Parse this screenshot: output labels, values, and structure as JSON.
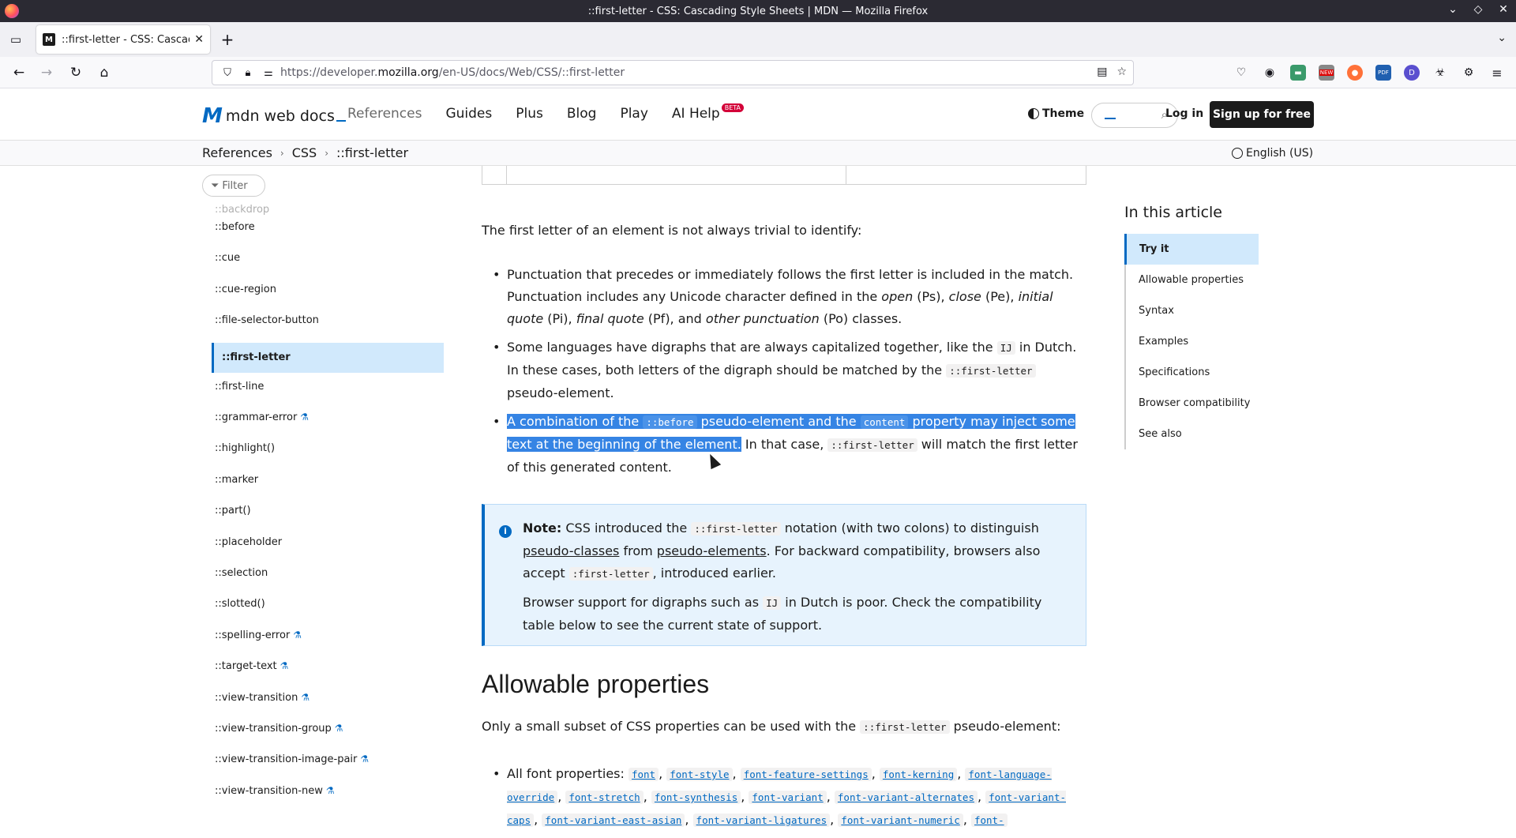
{
  "window": {
    "title": "::first-letter - CSS: Cascading Style Sheets | MDN — Mozilla Firefox"
  },
  "tab": {
    "title": "::first-letter - CSS: Cascading Style Sheets | MDN",
    "favicon": "M"
  },
  "urlbar": {
    "prefix": "https://developer.",
    "host": "mozilla.org",
    "path": "/en-US/docs/Web/CSS/::first-letter"
  },
  "extensions": {
    "new_badge": "NEW",
    "pdf_label": "PDF",
    "d_label": "D"
  },
  "header": {
    "logo": "mdn web docs",
    "nav": [
      "References",
      "Guides",
      "Plus",
      "Blog",
      "Play",
      "AI Help"
    ],
    "beta": "BETA",
    "theme": "Theme",
    "login": "Log in",
    "signup": "Sign up for free"
  },
  "breadcrumbs": [
    "References",
    "CSS",
    "::first-letter"
  ],
  "language": "English (US)",
  "sidebar": {
    "filter_placeholder": "Filter",
    "faded_item": "::backdrop",
    "items": [
      {
        "label": "::before",
        "experimental": false
      },
      {
        "label": "::cue",
        "experimental": false
      },
      {
        "label": "::cue-region",
        "experimental": false
      },
      {
        "label": "::file-selector-button",
        "experimental": false
      },
      {
        "label": "::first-letter",
        "experimental": false,
        "active": true
      },
      {
        "label": "::first-line",
        "experimental": false
      },
      {
        "label": "::grammar-error",
        "experimental": true
      },
      {
        "label": "::highlight()",
        "experimental": false
      },
      {
        "label": "::marker",
        "experimental": false
      },
      {
        "label": "::part()",
        "experimental": false
      },
      {
        "label": "::placeholder",
        "experimental": false
      },
      {
        "label": "::selection",
        "experimental": false
      },
      {
        "label": "::slotted()",
        "experimental": false
      },
      {
        "label": "::spelling-error",
        "experimental": true
      },
      {
        "label": "::target-text",
        "experimental": true
      },
      {
        "label": "::view-transition",
        "experimental": true
      },
      {
        "label": "::view-transition-group",
        "experimental": true
      },
      {
        "label": "::view-transition-image-pair",
        "experimental": true
      },
      {
        "label": "::view-transition-new",
        "experimental": true
      }
    ]
  },
  "content": {
    "intro": "The first letter of an element is not always trivial to identify:",
    "b1": {
      "t1": "Punctuation that precedes or immediately follows the first letter is included in the match. Punctuation includes any Unicode character defined in the ",
      "open": "open",
      "t2": " (Ps), ",
      "close": "close",
      "t3": " (Pe), ",
      "initial": "initial quote",
      "t4": " (Pi), ",
      "final": "final quote",
      "t5": " (Pf), and ",
      "other": "other punctuation",
      "t6": " (Po) classes."
    },
    "b2": {
      "t1": "Some languages have digraphs that are always capitalized together, like the ",
      "code1": "IJ",
      "t2": " in Dutch. In these cases, both letters of the digraph should be matched by the ",
      "code2": "::first-letter",
      "t3": " pseudo-element."
    },
    "b3": {
      "s1": "A combination of the ",
      "code1": "::before",
      "s2": " pseudo-element and the ",
      "code2": "content",
      "s3": " property may inject some text at the beginning of the element.",
      "t1": " In that case, ",
      "code3": "::first-letter",
      "t2": " will match the first letter of this generated content."
    },
    "note": {
      "label": "Note:",
      "t1": " CSS introduced the ",
      "code1": "::first-letter",
      "t2": " notation (with two colons) to distinguish ",
      "link1": "pseudo-classes",
      "t3": " from ",
      "link2": "pseudo-elements",
      "t4": ". For backward compatibility, browsers also accept ",
      "code2": ":first-letter",
      "t5": ", introduced earlier.",
      "p2_t1": "Browser support for digraphs such as ",
      "p2_code": "IJ",
      "p2_t2": " in Dutch is poor. Check the compatibility table below to see the current state of support."
    },
    "h2": "Allowable properties",
    "para2_t1": "Only a small subset of CSS properties can be used with the ",
    "para2_code": "::first-letter",
    "para2_t2": " pseudo-element:",
    "fonts_label": "All font properties: ",
    "font_props": [
      "font",
      "font-style",
      "font-feature-settings",
      "font-kerning",
      "font-language-override",
      "font-stretch",
      "font-synthesis",
      "font-variant",
      "font-variant-alternates",
      "font-variant-caps",
      "font-variant-east-asian",
      "font-variant-ligatures",
      "font-variant-numeric",
      "font-"
    ]
  },
  "toc": {
    "title": "In this article",
    "items": [
      "Try it",
      "Allowable properties",
      "Syntax",
      "Examples",
      "Specifications",
      "Browser compatibility",
      "See also"
    ]
  }
}
